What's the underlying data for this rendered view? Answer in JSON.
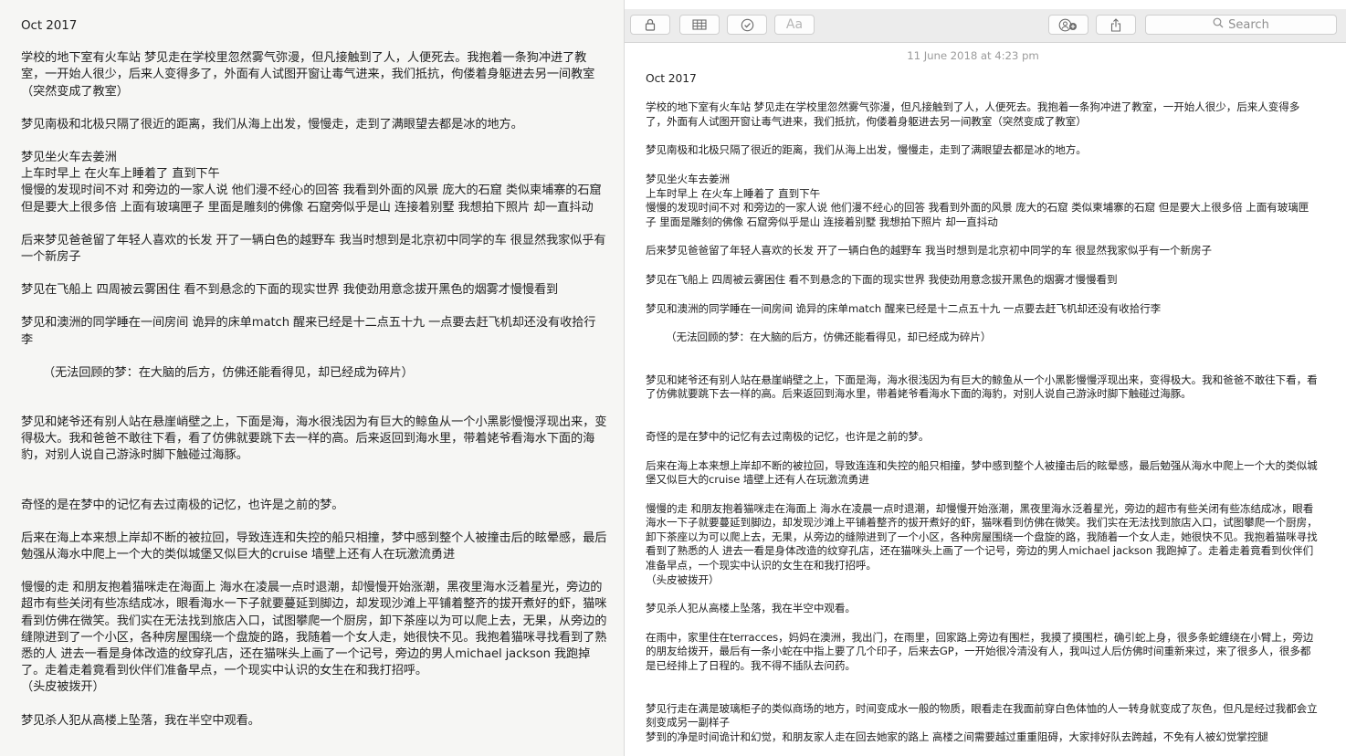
{
  "note": {
    "title": "Oct 2017",
    "timestamp": "11 June 2018 at 4:23 pm",
    "paragraphs": [
      "学校的地下室有火车站 梦见走在学校里忽然雾气弥漫，但凡接触到了人，人便死去。我抱着一条狗冲进了教室，一开始人很少，后来人变得多了，外面有人试图开窗让毒气进来，我们抵抗，佝偻着身躯进去另一间教室（突然变成了教室）",
      "梦见南极和北极只隔了很近的距离，我们从海上出发，慢慢走，走到了满眼望去都是冰的地方。",
      "梦见坐火车去姜洲\n上车时早上 在火车上睡着了 直到下午\n慢慢的发现时间不对 和旁边的一家人说 他们漫不经心的回答 我看到外面的风景 庞大的石窟 类似柬埔寨的石窟 但是要大上很多倍 上面有玻璃匣子 里面是雕刻的佛像 石窟旁似乎是山 连接着别墅 我想拍下照片 却一直抖动",
      "后来梦见爸爸留了年轻人喜欢的长发 开了一辆白色的越野车 我当时想到是北京初中同学的车 很显然我家似乎有一个新房子",
      "梦见在飞船上 四周被云雾困住 看不到悬念的下面的现实世界 我使劲用意念拔开黑色的烟雾才慢慢看到",
      "梦见和澳洲的同学睡在一间房间 诡异的床单match 醒来已经是十二点五十九 一点要去赶飞机却还没有收拾行李",
      "（无法回顾的梦：在大脑的后方，仿佛还能看得见，却已经成为碎片）",
      "梦见和姥爷还有别人站在悬崖峭壁之上，下面是海，海水很浅因为有巨大的鲸鱼从一个小黑影慢慢浮现出来，变得极大。我和爸爸不敢往下看，看了仿佛就要跳下去一样的高。后来返回到海水里，带着姥爷看海水下面的海豹，对别人说自己游泳时脚下触碰过海豚。",
      "奇怪的是在梦中的记忆有去过南极的记忆，也许是之前的梦。",
      "后来在海上本来想上岸却不断的被拉回，导致连连和失控的船只相撞，梦中感到整个人被撞击后的眩晕感，最后勉强从海水中爬上一个大的类似城堡又似巨大的cruise 墙壁上还有人在玩激流勇进",
      "慢慢的走 和朋友抱着猫咪走在海面上 海水在凌晨一点时退潮，却慢慢开始涨潮，黑夜里海水泛着星光，旁边的超市有些关闭有些冻结成冰，眼看海水一下子就要蔓延到脚边，却发现沙滩上平铺着整齐的拔开煮好的虾，猫咪看到仿佛在微笑。我们实在无法找到旅店入口，试图攀爬一个厨房，卸下茶座以为可以爬上去，无果，从旁边的缝隙进到了一个小区，各种房屋围绕一个盘旋的路，我随着一个女人走，她很快不见。我抱着猫咪寻找看到了熟悉的人 进去一看是身体改造的纹穿孔店，还在猫咪头上画了一个记号，旁边的男人michael jackson 我跑掉了。走着走着竟看到伙伴们准备早点，一个现实中认识的女生在和我打招呼。\n（头皮被拨开）",
      "梦见杀人犯从高楼上坠落，我在半空中观看。",
      "在雨中，家里住在terracces，妈妈在澳洲，我出门，在雨里，回家路上旁边有围栏，我摸了摸围栏，确引蛇上身，很多条蛇缠绕在小臂上，旁边的朋友给拨开，最后有一条小蛇在中指上要了几个印子，后来去GP，一开始很冷清没有人，我叫过人后仿佛时间重新来过，来了很多人，很多都是已经排上了日程的。我不得不插队去问药。",
      "梦见行走在满是玻璃柜子的类似商场的地方，时间变成水一般的物质，眼看走在我面前穿白色体恤的人一转身就变成了灰色，但凡是经过我都会立刻变成另一副样子\n梦到的净是时间诡计和幻觉，和朋友家人走在回去她家的路上 高楼之间需要越过重重阻碍，大家排好队去跨越，不免有人被幻觉掌控腿"
    ]
  },
  "toolbar": {
    "format_label": "Aa",
    "search_placeholder": "Search"
  }
}
